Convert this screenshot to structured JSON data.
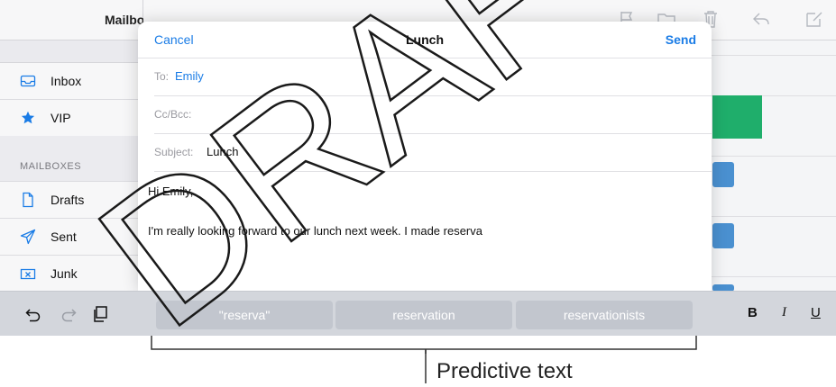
{
  "sidebar": {
    "title": "Mailboxes",
    "items": [
      {
        "label": "Inbox",
        "icon": "inbox-icon"
      },
      {
        "label": "VIP",
        "icon": "star-icon"
      }
    ],
    "section_label": "MAILBOXES",
    "mailboxes": [
      {
        "label": "Drafts",
        "icon": "document-icon"
      },
      {
        "label": "Sent",
        "icon": "paper-plane-icon"
      },
      {
        "label": "Junk",
        "icon": "junk-icon"
      }
    ]
  },
  "compose": {
    "cancel_label": "Cancel",
    "title": "Lunch",
    "send_label": "Send",
    "to_label": "To:",
    "to_value": "Emily",
    "ccbcc_label": "Cc/Bcc:",
    "subject_label": "Subject:",
    "subject_value": "Lunch",
    "body_line1": "Hi Emily,",
    "body_line2": "I'm really looking forward to our lunch next week. I made reserva"
  },
  "keyboard_bar": {
    "predictions": [
      "\"reserva\"",
      "reservation",
      "reservationists"
    ],
    "bold_label": "B",
    "italic_label": "I",
    "underline_label": "U"
  },
  "callout": {
    "label": "Predictive text"
  },
  "watermark": {
    "text": "DRAFT"
  },
  "colors": {
    "accent": "#1a7ce6",
    "green": "#1fae6b",
    "blue_chip": "#4a90d0",
    "keyboard_bar": "#d3d6dc",
    "prediction_key": "#c2c6ce"
  }
}
